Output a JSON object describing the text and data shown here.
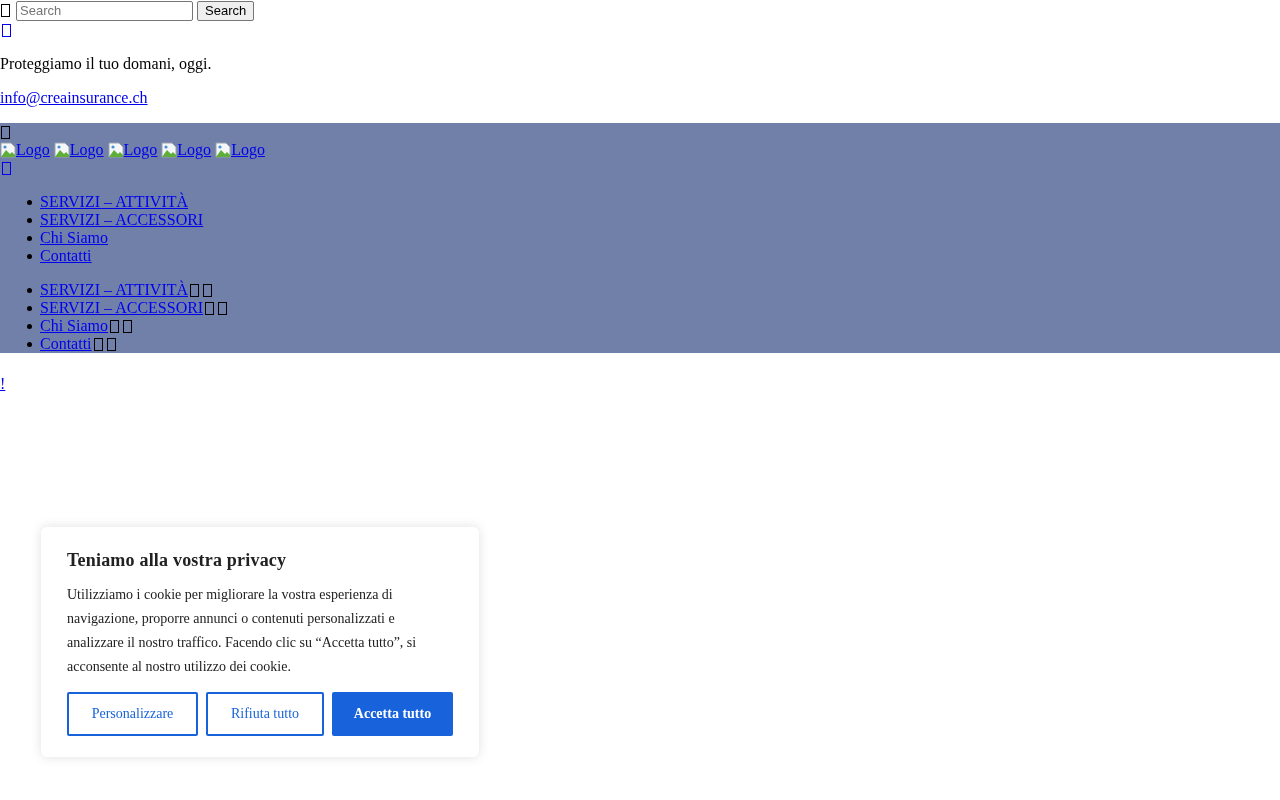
{
  "search": {
    "placeholder": "Search",
    "button": "Search"
  },
  "tagline": "Proteggiamo il tuo domani, oggi.",
  "email": "info@creainsurance.ch",
  "header": {
    "logos": [
      "Logo",
      "Logo",
      "Logo",
      "Logo",
      "Logo"
    ],
    "menu": [
      "SERVIZI – ATTIVITÀ",
      "SERVIZI – ACCESSORI",
      "Chi Siamo",
      "Contatti"
    ],
    "mobile_menu": [
      "SERVIZI – ATTIVITÀ",
      "SERVIZI – ACCESSORI",
      "Chi Siamo",
      "Contatti"
    ]
  },
  "footer_link": "!",
  "cookie_banner": {
    "title": "Teniamo alla vostra privacy",
    "text": "Utilizziamo i cookie per migliorare la vostra esperienza di navigazione, proporre annunci o contenuti personalizzati e analizzare il nostro traffico. Facendo clic su “Accetta tutto”, si acconsente al nostro utilizzo dei cookie.",
    "buttons": [
      {
        "label": "Personalizzare",
        "kind": "outline"
      },
      {
        "label": "Rifiuta tutto",
        "kind": "outline"
      },
      {
        "label": "Accetta tutto",
        "kind": "filled"
      }
    ]
  }
}
